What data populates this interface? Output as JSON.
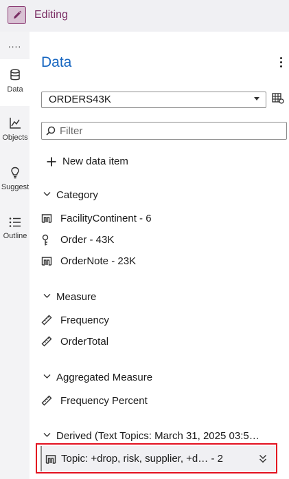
{
  "header": {
    "mode_label": "Editing",
    "edit_icon": "pencil-icon"
  },
  "rail": {
    "more_label": "....",
    "items": [
      {
        "label": "Data",
        "icon": "database-icon"
      },
      {
        "label": "Objects",
        "icon": "line-chart-icon"
      },
      {
        "label": "Suggest",
        "icon": "lightbulb-icon"
      },
      {
        "label": "Outline",
        "icon": "list-icon"
      }
    ]
  },
  "panel": {
    "title": "Data",
    "data_source": "ORDERS43K",
    "filter_placeholder": "Filter",
    "new_item_label": "New data item",
    "groups": [
      {
        "label": "Category",
        "items": [
          {
            "label": "FacilityContinent - 6",
            "icon": "category-icon"
          },
          {
            "label": "Order - 43K",
            "icon": "key-icon"
          },
          {
            "label": "OrderNote - 23K",
            "icon": "category-icon"
          }
        ]
      },
      {
        "label": "Measure",
        "items": [
          {
            "label": "Frequency",
            "icon": "measure-icon"
          },
          {
            "label": "OrderTotal",
            "icon": "measure-icon"
          }
        ]
      },
      {
        "label": "Aggregated Measure",
        "items": [
          {
            "label": "Frequency Percent",
            "icon": "measure-icon"
          }
        ]
      },
      {
        "label": "Derived (Text Topics: March 31, 2025 03:5…",
        "items": [
          {
            "label": "Topic: +drop, risk, supplier, +d…  - 2",
            "icon": "category-icon"
          }
        ]
      }
    ]
  },
  "colors": {
    "accent": "#1565c0",
    "mode": "#7a2d63",
    "highlight": "#e3101f"
  }
}
